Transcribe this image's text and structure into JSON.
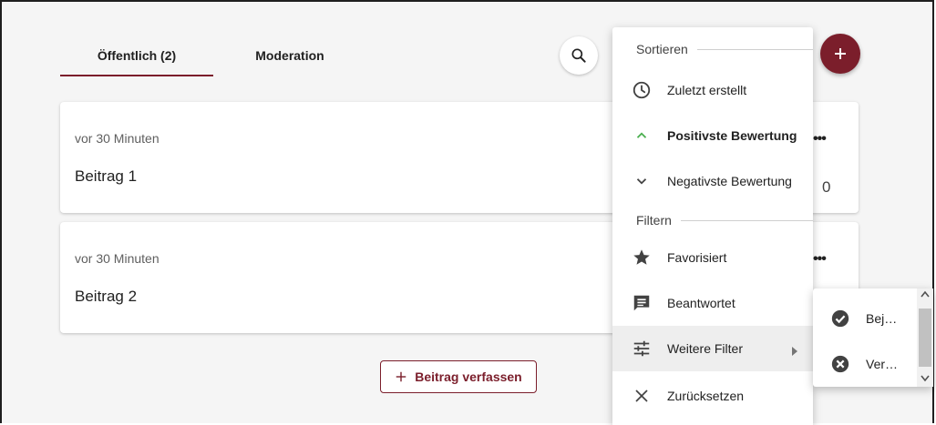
{
  "tabs": [
    {
      "label": "Öffentlich (2)",
      "active": true
    },
    {
      "label": "Moderation",
      "active": false
    }
  ],
  "posts": [
    {
      "time": "vor 30 Minuten",
      "title": "Beitrag 1",
      "votes": "0",
      "more": "•••"
    },
    {
      "time": "vor 30 Minuten",
      "title": "Beitrag 2",
      "more": "•••"
    }
  ],
  "compose_button": {
    "icon": "plus-icon",
    "label": "Beitrag verfassen"
  },
  "menu": {
    "sort_header": "Sortieren",
    "sort_items": [
      {
        "label": "Zuletzt erstellt",
        "icon": "clock-icon"
      },
      {
        "label": "Positivste Bewertung",
        "icon": "chevron-up-icon",
        "selected": true
      },
      {
        "label": "Negativste Bewertung",
        "icon": "chevron-down-icon"
      }
    ],
    "filter_header": "Filtern",
    "filter_items": [
      {
        "label": "Favorisiert",
        "icon": "star-icon"
      },
      {
        "label": "Beantwortet",
        "icon": "comment-icon"
      },
      {
        "label": "Weitere Filter",
        "icon": "tune-icon",
        "highlighted": true,
        "has_submenu": true
      },
      {
        "label": "Zurücksetzen",
        "icon": "close-icon"
      }
    ]
  },
  "submenu": {
    "items": [
      {
        "label": "Bej…",
        "icon": "check-circle-icon"
      },
      {
        "label": "Ver…",
        "icon": "cancel-circle-icon"
      }
    ]
  },
  "colors": {
    "accent": "#7b1e2b",
    "positive": "#4caf50",
    "background": "#f5f5f5"
  }
}
